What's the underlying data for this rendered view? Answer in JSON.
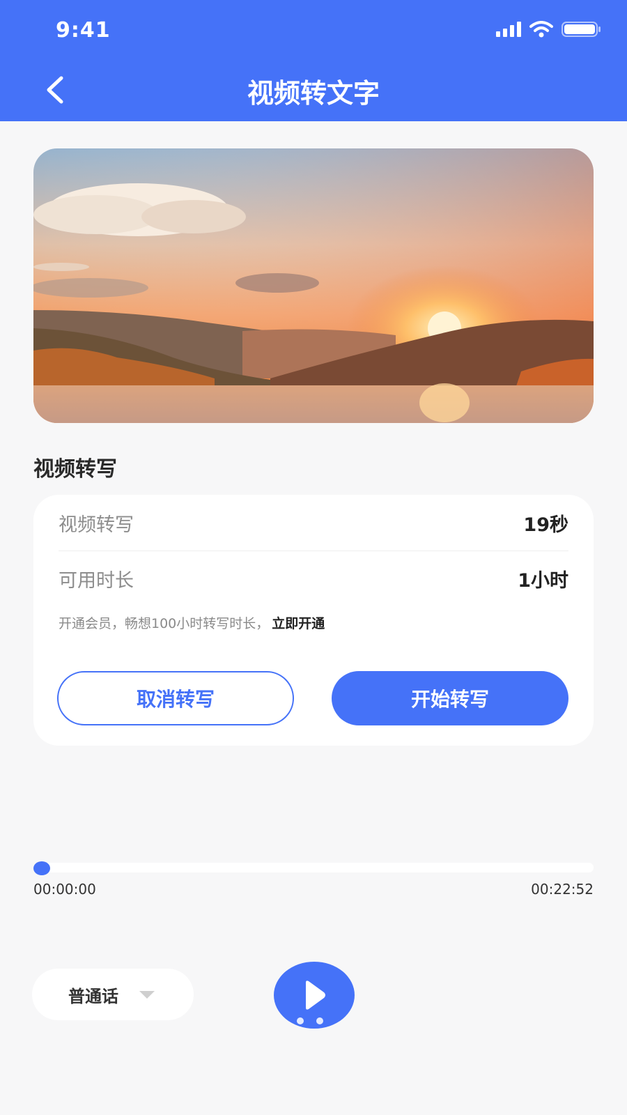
{
  "status_bar": {
    "time": "9:41"
  },
  "header": {
    "title": "视频转文字"
  },
  "section": {
    "title": "视频转写"
  },
  "card": {
    "row1": {
      "label": "视频转写",
      "value": "19秒"
    },
    "row2": {
      "label": "可用时长",
      "value": "1小时"
    },
    "promo_text": "开通会员，畅想100小时转写时长，",
    "promo_link": "立即开通",
    "cancel_label": "取消转写",
    "start_label": "开始转写"
  },
  "player": {
    "current_time": "00:00:00",
    "duration": "00:22:52",
    "progress": 0,
    "language": "普通话",
    "page_dots": 2
  },
  "colors": {
    "accent": "#4572f8",
    "background": "#f7f7f8"
  },
  "icons": [
    "back-arrow-icon",
    "signal-icon",
    "wifi-icon",
    "battery-icon",
    "dropdown-caret-icon",
    "play-icon"
  ]
}
